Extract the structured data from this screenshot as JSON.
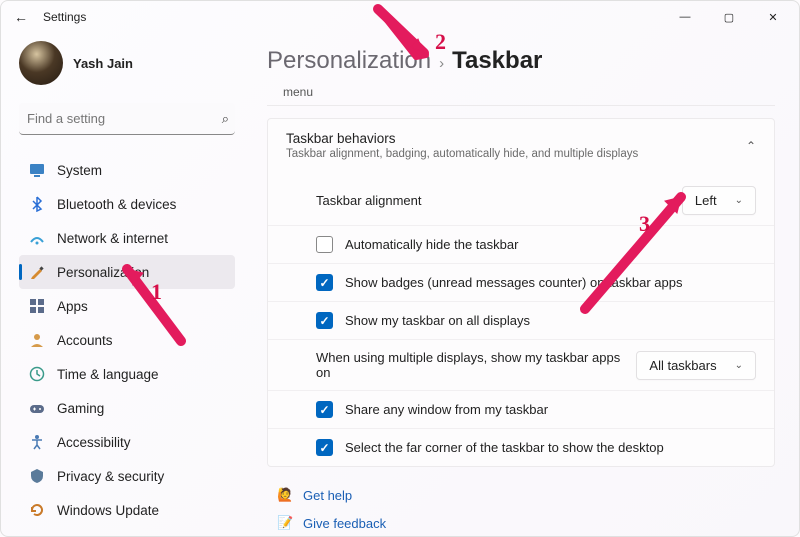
{
  "app_title": "Settings",
  "user_name": "Yash Jain",
  "search_placeholder": "Find a setting",
  "nav": [
    {
      "label": "System",
      "icon": "system"
    },
    {
      "label": "Bluetooth & devices",
      "icon": "bluetooth"
    },
    {
      "label": "Network & internet",
      "icon": "network"
    },
    {
      "label": "Personalization",
      "icon": "personalization",
      "selected": true
    },
    {
      "label": "Apps",
      "icon": "apps"
    },
    {
      "label": "Accounts",
      "icon": "accounts"
    },
    {
      "label": "Time & language",
      "icon": "time"
    },
    {
      "label": "Gaming",
      "icon": "gaming"
    },
    {
      "label": "Accessibility",
      "icon": "accessibility"
    },
    {
      "label": "Privacy & security",
      "icon": "privacy"
    },
    {
      "label": "Windows Update",
      "icon": "update"
    }
  ],
  "breadcrumb": {
    "parent": "Personalization",
    "current": "Taskbar"
  },
  "truncated_row": "menu",
  "section": {
    "title": "Taskbar behaviors",
    "subtitle": "Taskbar alignment, badging, automatically hide, and multiple displays"
  },
  "rows": {
    "alignment_label": "Taskbar alignment",
    "alignment_value": "Left",
    "auto_hide": "Automatically hide the taskbar",
    "badges": "Show badges (unread messages counter) on taskbar apps",
    "all_displays": "Show my taskbar on all displays",
    "multi_label": "When using multiple displays, show my taskbar apps on",
    "multi_value": "All taskbars",
    "share_window": "Share any window from my taskbar",
    "far_corner": "Select the far corner of the taskbar to show the desktop"
  },
  "footer": {
    "get_help": "Get help",
    "give_feedback": "Give feedback"
  },
  "annotations": {
    "n1": "1",
    "n2": "2",
    "n3": "3"
  }
}
